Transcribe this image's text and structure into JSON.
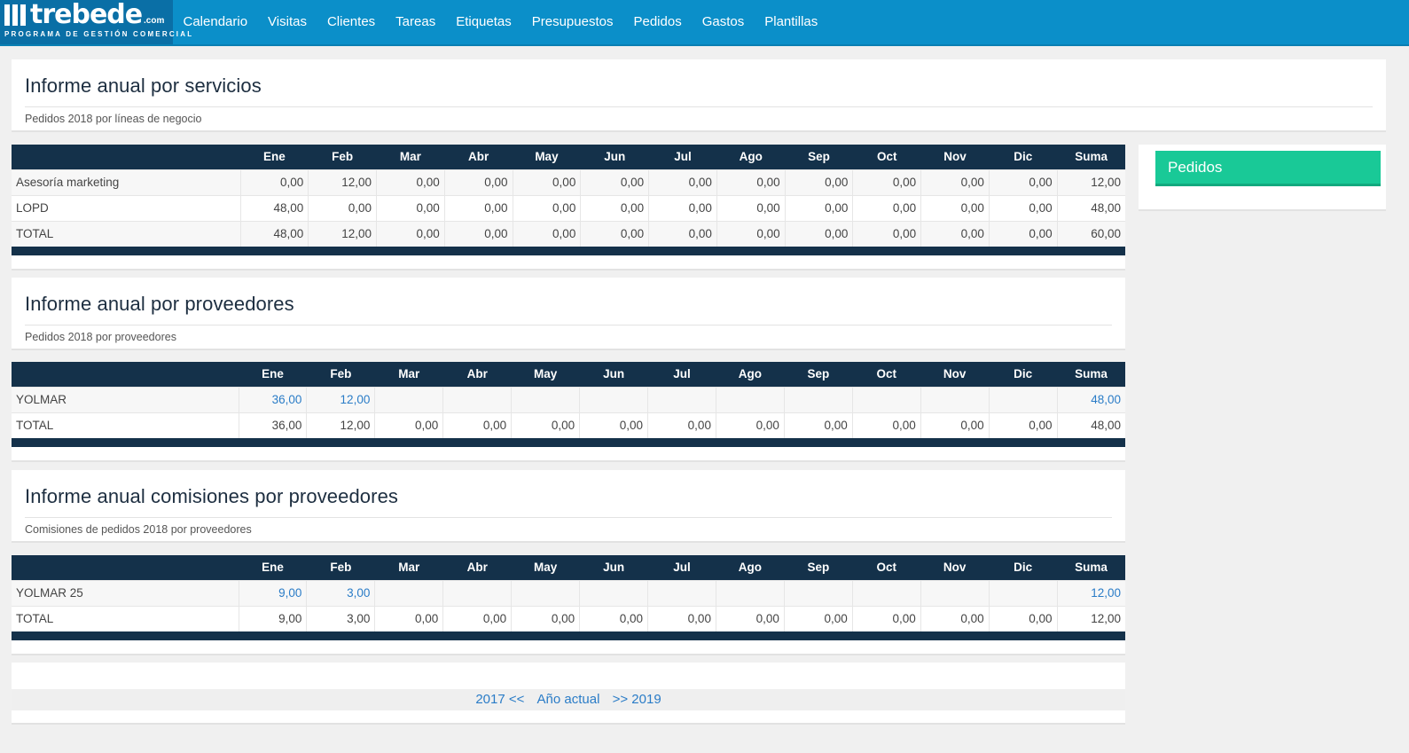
{
  "brand": {
    "name": "trebede",
    "suffix": ".com",
    "tagline": "PROGRAMA DE GESTIÓN COMERCIAL"
  },
  "nav": [
    "Calendario",
    "Visitas",
    "Clientes",
    "Tareas",
    "Etiquetas",
    "Presupuestos",
    "Pedidos",
    "Gastos",
    "Plantillas"
  ],
  "months": [
    "Ene",
    "Feb",
    "Mar",
    "Abr",
    "May",
    "Jun",
    "Jul",
    "Ago",
    "Sep",
    "Oct",
    "Nov",
    "Dic",
    "Suma"
  ],
  "report1": {
    "title": "Informe anual por servicios",
    "subtitle": "Pedidos 2018 por líneas de negocio",
    "rows": [
      {
        "label": "Asesoría marketing",
        "values": [
          "0,00",
          "12,00",
          "0,00",
          "0,00",
          "0,00",
          "0,00",
          "0,00",
          "0,00",
          "0,00",
          "0,00",
          "0,00",
          "0,00",
          "12,00"
        ]
      },
      {
        "label": "LOPD",
        "values": [
          "48,00",
          "0,00",
          "0,00",
          "0,00",
          "0,00",
          "0,00",
          "0,00",
          "0,00",
          "0,00",
          "0,00",
          "0,00",
          "0,00",
          "48,00"
        ]
      },
      {
        "label": "TOTAL",
        "values": [
          "48,00",
          "12,00",
          "0,00",
          "0,00",
          "0,00",
          "0,00",
          "0,00",
          "0,00",
          "0,00",
          "0,00",
          "0,00",
          "0,00",
          "60,00"
        ]
      }
    ]
  },
  "report2": {
    "title": "Informe anual por proveedores",
    "subtitle": "Pedidos 2018 por proveedores",
    "rows": [
      {
        "label": "YOLMAR",
        "values": [
          "36,00",
          "12,00",
          "",
          "",
          "",
          "",
          "",
          "",
          "",
          "",
          "",
          "",
          "48,00"
        ]
      },
      {
        "label": "TOTAL",
        "values": [
          "36,00",
          "12,00",
          "0,00",
          "0,00",
          "0,00",
          "0,00",
          "0,00",
          "0,00",
          "0,00",
          "0,00",
          "0,00",
          "0,00",
          "48,00"
        ]
      }
    ]
  },
  "report3": {
    "title": "Informe anual comisiones por proveedores",
    "subtitle": "Comisiones de pedidos 2018 por proveedores",
    "rows": [
      {
        "label": "YOLMAR 25",
        "values": [
          "9,00",
          "3,00",
          "",
          "",
          "",
          "",
          "",
          "",
          "",
          "",
          "",
          "",
          "12,00"
        ]
      },
      {
        "label": "TOTAL",
        "values": [
          "9,00",
          "3,00",
          "0,00",
          "0,00",
          "0,00",
          "0,00",
          "0,00",
          "0,00",
          "0,00",
          "0,00",
          "0,00",
          "0,00",
          "12,00"
        ]
      }
    ]
  },
  "sidebar": {
    "title": "Pedidos"
  },
  "yearnav": {
    "prev": "2017 <<",
    "current": "Año actual",
    "next": ">> 2019"
  },
  "colors": {
    "nav": "#0b8fc9",
    "table_header": "#14314a",
    "accent_green": "#19c997",
    "link": "#2a7cc7"
  }
}
